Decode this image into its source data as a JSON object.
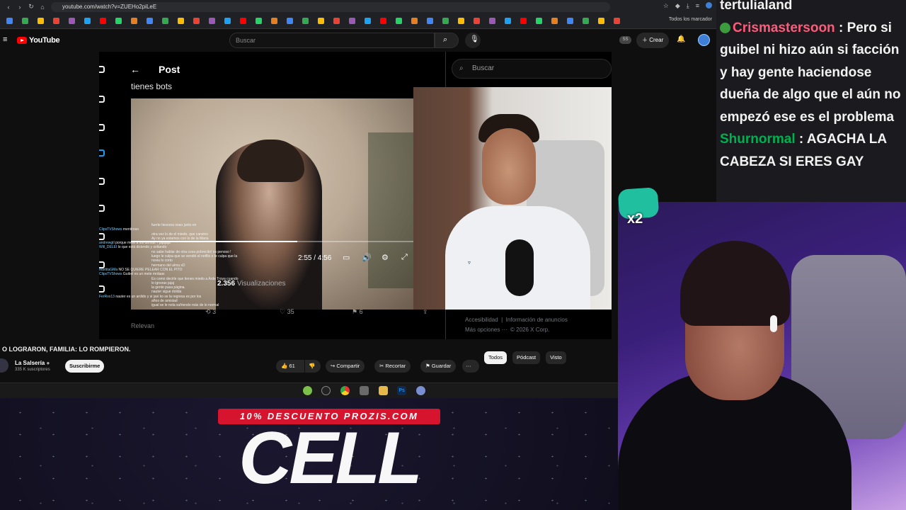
{
  "browser": {
    "url": "youtube.com/watch?v=ZUEHo2piLeE",
    "bookmarks_all_label": "Todos los marcador"
  },
  "youtube": {
    "logo_text": "YouTube",
    "search_placeholder": "Buscar",
    "badge_text": "SS",
    "create_label": "Crear"
  },
  "x_post": {
    "header_title": "Post",
    "post_text": "tienes bots",
    "video_time": "2:55 / 4:56",
    "views_count": "2.356",
    "views_label": "Visualizaciones",
    "reposts": "3",
    "likes": "35",
    "bookmarks": "6",
    "relevant_label": "Relevan",
    "search_placeholder": "Buscar",
    "footer": {
      "accessibility": "Accesibilidad",
      "ads_info": "Información de anuncios",
      "more": "Más opciones ···",
      "copyright": "© 2026 X Corp."
    },
    "overlay_chat": [
      {
        "name": "",
        "text": "fuerte tiesoora soao junto en"
      },
      {
        "name": "ClipsTVShows",
        "text": "mentiroso"
      },
      {
        "name": "",
        "text": "otra vez lo de el miedo. que cansino"
      },
      {
        "name": "",
        "text": "Ay no ya estamos con lo de la Maria"
      },
      {
        "name": "andrewgtl",
        "text": "porque mete a los demás ? jajajaja"
      },
      {
        "name": "Will_DELEI",
        "text": "lo que está diciendo y soltando"
      },
      {
        "name": "",
        "text": "no sabe hablar de otra cosa pobrecito! es penoso !"
      },
      {
        "name": "",
        "text": "luego le culpa que se vendió el netflix o te culpa que la"
      },
      {
        "name": "",
        "text": "novia lo corto"
      },
      {
        "name": "",
        "text": "hermano del alma xD"
      },
      {
        "name": "MartitaGMa",
        "text": "NO SE QUIERE PELEAR CON EL PITO"
      },
      {
        "name": "ClipsTVShows",
        "text": "Guibel es un mete mrdaas"
      },
      {
        "name": "",
        "text": "Es como decirle que tienes miedo a Arde Troya cuando"
      },
      {
        "name": "",
        "text": "lo ignoras jajaj"
      },
      {
        "name": "",
        "text": "la gente pasa página."
      },
      {
        "name": "",
        "text": "nauter sigue dolida"
      },
      {
        "name": "FerRox13",
        "text": "nauter es un ardido y si javi ko se la regresa es por los"
      },
      {
        "name": "",
        "text": "años de amistad"
      },
      {
        "name": "",
        "text": "igual se le nota sufriendo más de lo normal"
      }
    ]
  },
  "yt_video": {
    "title": "O LOGRARON, FAMILIA: LO ROMPIERON.",
    "channel": "La Salsería",
    "subscribers": "335 K suscriptores",
    "subscribe_label": "Suscribirme",
    "likes": "61",
    "share_label": "Compartir",
    "clip_label": "Recortar",
    "save_label": "Guardar",
    "more_label": "···",
    "chips": [
      "Todos",
      "Pódcast",
      "Visto"
    ]
  },
  "twitch_chat": {
    "top_name": "tertulialand",
    "messages": [
      {
        "user": "Crismastersoon",
        "text": "Pero si guibel ni hizo aún si facción y hay gente haciendose dueña de algo que el aún no empezó ese es el problema"
      },
      {
        "user": "Shurnormal",
        "text": "AGACHA LA CABEZA SI ERES GAY"
      }
    ]
  },
  "emote": {
    "multiplier": "x2"
  },
  "promo": {
    "strip_text": "10% DESCUENTO PROZIS.COM",
    "code": "CELL"
  },
  "colors": {
    "youtube_red": "#ff0000",
    "promo_red": "#d6142e",
    "chat_bg": "#1b1b1f",
    "username_green": "#00b050",
    "username_red": "#ff5a7a"
  },
  "icons": [
    "menu-icon",
    "search-icon",
    "mic-icon",
    "bell-icon",
    "back-arrow-icon",
    "like-icon",
    "dislike-icon",
    "share-icon",
    "scissors-icon",
    "bookmark-icon",
    "settings-icon",
    "volume-icon",
    "captions-icon",
    "fullscreen-icon",
    "repost-icon",
    "heart-icon"
  ]
}
